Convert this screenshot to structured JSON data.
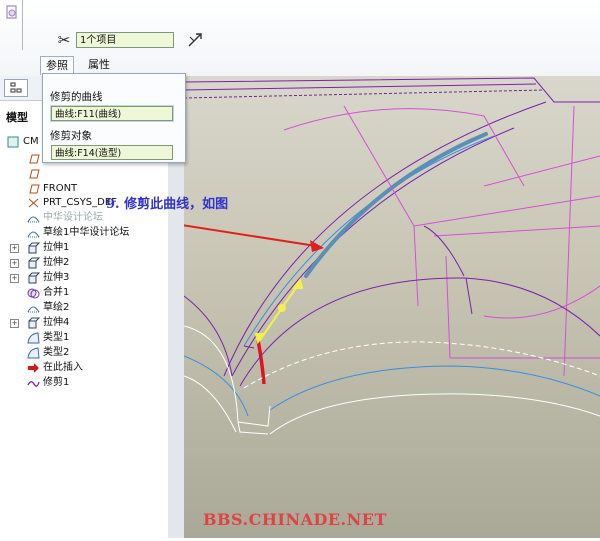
{
  "dashboard": {
    "item_field_value": "1个项目",
    "tabs": [
      {
        "label": "参照",
        "active": true
      },
      {
        "label": "属性",
        "active": false
      }
    ]
  },
  "ref_popup": {
    "trim_curve_label": "修剪的曲线",
    "trim_curve_value": "曲线:F11(曲线)",
    "trim_object_label": "修剪对象",
    "trim_object_value": "曲线:F14(造型)"
  },
  "tree": {
    "title": "模型",
    "items": [
      {
        "label": "CM",
        "icon": "part-icon"
      },
      {
        "label": "",
        "icon": "datum-plane-icon"
      },
      {
        "label": "",
        "icon": "datum-plane-icon"
      },
      {
        "label": "FRONT",
        "icon": "datum-plane-icon"
      },
      {
        "label": "PRT_CSYS_DEF",
        "icon": "csys-icon"
      },
      {
        "label": "中华设计论坛",
        "icon": "sketch-icon",
        "greyed": true
      },
      {
        "label": "草绘1中华设计论坛",
        "icon": "sketch-icon"
      },
      {
        "label": "拉伸1",
        "icon": "extrude-icon",
        "expandable": true
      },
      {
        "label": "拉伸2",
        "icon": "extrude-icon",
        "expandable": true
      },
      {
        "label": "拉伸3",
        "icon": "extrude-icon",
        "expandable": true
      },
      {
        "label": "合并1",
        "icon": "merge-icon"
      },
      {
        "label": "草绘2",
        "icon": "sketch-icon"
      },
      {
        "label": "拉伸4",
        "icon": "extrude-icon",
        "expandable": true
      },
      {
        "label": "类型1",
        "icon": "style-icon"
      },
      {
        "label": "类型2",
        "icon": "style-icon"
      },
      {
        "label": "在此插入",
        "icon": "insert-arrow-icon"
      },
      {
        "label": "修剪1",
        "icon": "trim-icon"
      }
    ]
  },
  "viewport": {
    "annotation": "9. 修剪此曲线，如图",
    "watermark": "BBS.CHINADE.NET"
  },
  "colors": {
    "annotation_text": "#3333cc",
    "watermark_text": "#dd4444",
    "field_bg": "#eef8d8",
    "curve_purple": "#7a22a8",
    "curve_magenta": "#d64fd6",
    "curve_blue": "#3b8ee0",
    "highlight_curve": "#5a8fb8",
    "trim_curve_red": "#e0141e",
    "arrow_yellow": "#f3f04a"
  }
}
